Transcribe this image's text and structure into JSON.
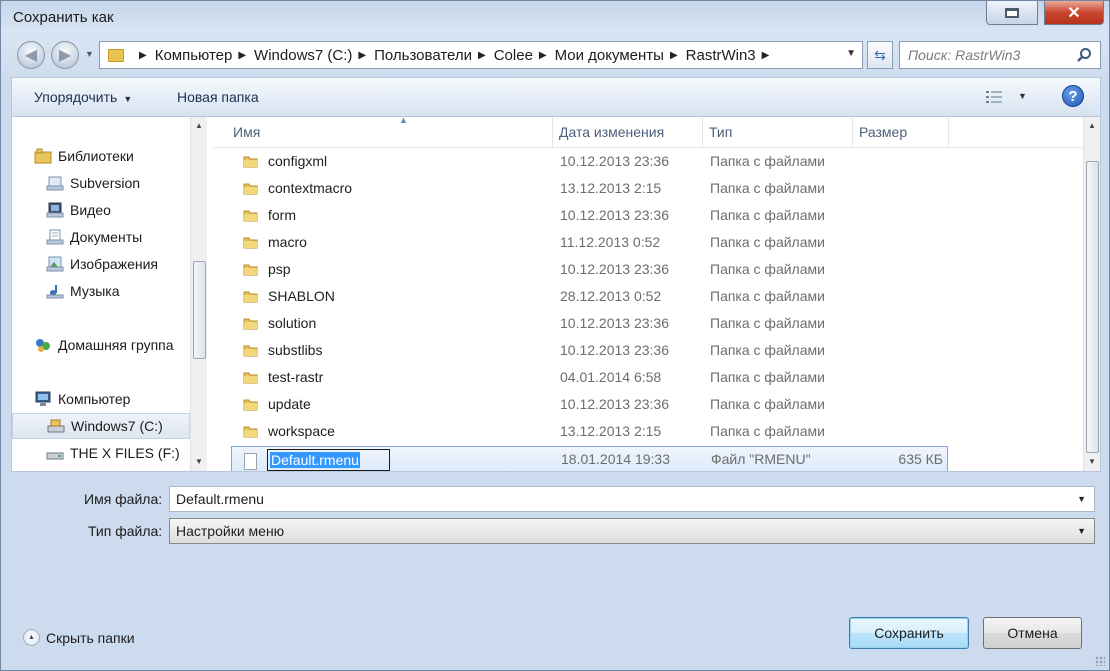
{
  "window": {
    "title": "Сохранить как"
  },
  "address": {
    "crumbs": [
      "Компьютер",
      "Windows7 (C:)",
      "Пользователи",
      "Colee",
      "Мои документы",
      "RastrWin3"
    ]
  },
  "search": {
    "placeholder": "Поиск: RastrWin3"
  },
  "toolbar": {
    "organize_label": "Упорядочить",
    "new_folder_label": "Новая папка"
  },
  "nav": {
    "items": [
      {
        "label": "Библиотеки",
        "icon": "libraries-icon"
      },
      {
        "label": "Subversion",
        "icon": "library-icon"
      },
      {
        "label": "Видео",
        "icon": "video-library-icon"
      },
      {
        "label": "Документы",
        "icon": "documents-library-icon"
      },
      {
        "label": "Изображения",
        "icon": "pictures-library-icon"
      },
      {
        "label": "Музыка",
        "icon": "music-library-icon"
      },
      {
        "label": "Домашняя группа",
        "icon": "homegroup-icon"
      },
      {
        "label": "Компьютер",
        "icon": "computer-icon"
      },
      {
        "label": "Windows7 (C:)",
        "icon": "drive-icon",
        "selected": true
      },
      {
        "label": "THE X FILES (F:)",
        "icon": "drive-icon"
      }
    ]
  },
  "columns": {
    "name": "Имя",
    "date": "Дата изменения",
    "type": "Тип",
    "size": "Размер"
  },
  "files": [
    {
      "name": "configxml",
      "date": "10.12.2013 23:36",
      "type": "Папка с файлами",
      "size": ""
    },
    {
      "name": "contextmacro",
      "date": "13.12.2013 2:15",
      "type": "Папка с файлами",
      "size": ""
    },
    {
      "name": "form",
      "date": "10.12.2013 23:36",
      "type": "Папка с файлами",
      "size": ""
    },
    {
      "name": "macro",
      "date": "11.12.2013 0:52",
      "type": "Папка с файлами",
      "size": ""
    },
    {
      "name": "psp",
      "date": "10.12.2013 23:36",
      "type": "Папка с файлами",
      "size": ""
    },
    {
      "name": "SHABLON",
      "date": "28.12.2013 0:52",
      "type": "Папка с файлами",
      "size": ""
    },
    {
      "name": "solution",
      "date": "10.12.2013 23:36",
      "type": "Папка с файлами",
      "size": ""
    },
    {
      "name": "substlibs",
      "date": "10.12.2013 23:36",
      "type": "Папка с файлами",
      "size": ""
    },
    {
      "name": "test-rastr",
      "date": "04.01.2014 6:58",
      "type": "Папка с файлами",
      "size": ""
    },
    {
      "name": "update",
      "date": "10.12.2013 23:36",
      "type": "Папка с файлами",
      "size": ""
    },
    {
      "name": "workspace",
      "date": "13.12.2013 2:15",
      "type": "Папка с файлами",
      "size": ""
    },
    {
      "name": "Default.rmenu",
      "date": "18.01.2014 19:33",
      "type": "Файл \"RMENU\"",
      "size": "635 КБ",
      "selected": true
    }
  ],
  "form": {
    "filename_label": "Имя файла:",
    "filename_value": "Default.rmenu",
    "filetype_label": "Тип файла:",
    "filetype_value": "Настройки меню"
  },
  "footer": {
    "hide_folders_label": "Скрыть папки",
    "save_label": "Сохранить",
    "cancel_label": "Отмена"
  },
  "colors": {
    "frame": "#cddbee",
    "selection": "#3399ff",
    "link_text": "#1d3050"
  }
}
